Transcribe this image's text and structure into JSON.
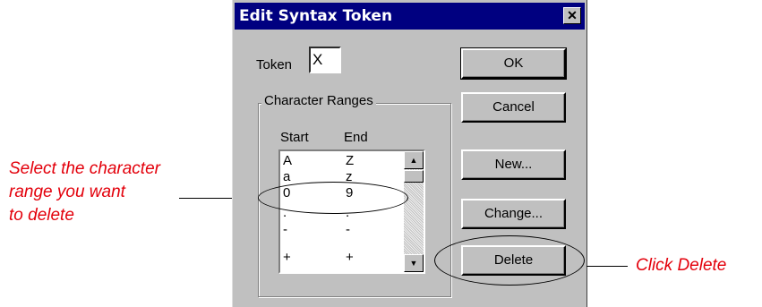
{
  "dialog": {
    "title": "Edit Syntax Token",
    "close_symbol": "✕",
    "token_label": "Token",
    "token_value": "X",
    "group_label": "Character Ranges",
    "col_start": "Start",
    "col_end": "End",
    "rows": [
      {
        "start": "A",
        "end": "Z"
      },
      {
        "start": "a",
        "end": "z"
      },
      {
        "start": "0",
        "end": "9"
      },
      {
        "start": ".",
        "end": "."
      },
      {
        "start": "-",
        "end": "-"
      },
      {
        "start": "+",
        "end": "+"
      }
    ],
    "buttons": {
      "ok": "OK",
      "cancel": "Cancel",
      "new": "New...",
      "change": "Change...",
      "delete": "Delete"
    },
    "scroll_up": "▲",
    "scroll_down": "▼"
  },
  "annotations": {
    "left_line1": "Select the character",
    "left_line2": "range you want",
    "left_line3": "to delete",
    "right": "Click Delete",
    "color": "#e3000b"
  },
  "colors": {
    "titlebar": "#000080",
    "dialog_bg": "#c0c0c0"
  }
}
